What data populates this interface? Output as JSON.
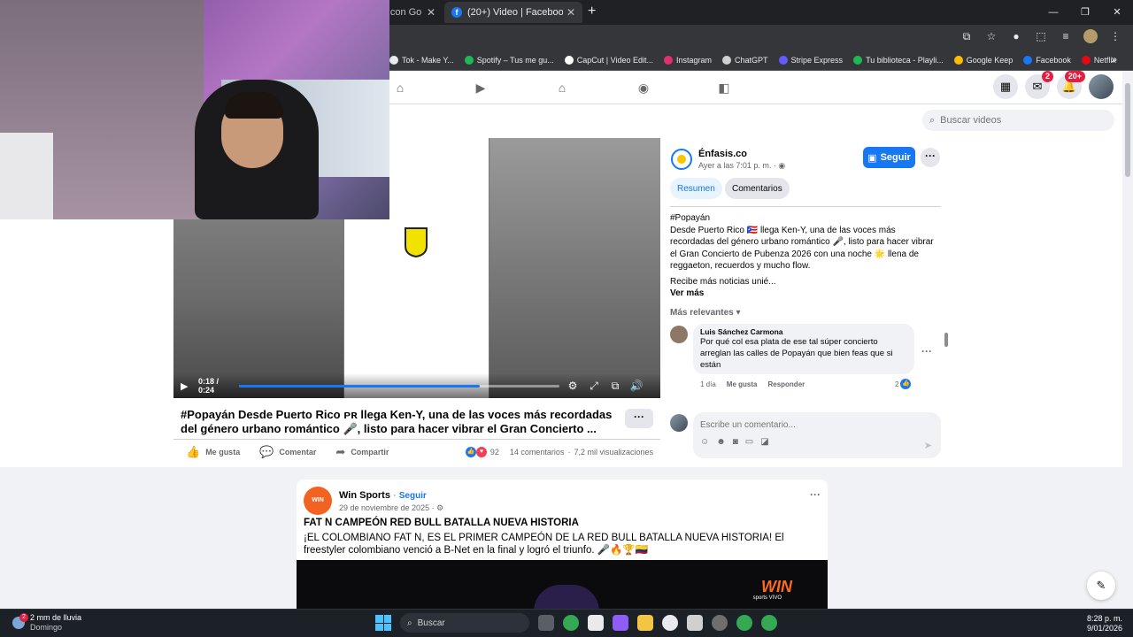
{
  "browser": {
    "tabs": [
      {
        "label": "ar con Go",
        "active": false
      },
      {
        "label": "(20+) Video | Facebook",
        "active": true
      }
    ],
    "new_tab": "+",
    "bookmarks": [
      {
        "label": "Tok - Make Y...",
        "color": "#e8eaed"
      },
      {
        "label": "Spotify – Tus me gu...",
        "color": "#1db954"
      },
      {
        "label": "CapCut | Video Edit...",
        "color": "#ffffff"
      },
      {
        "label": "Instagram",
        "color": "#e1306c"
      },
      {
        "label": "ChatGPT",
        "color": "#d0d0d0"
      },
      {
        "label": "Stripe Express",
        "color": "#635bff"
      },
      {
        "label": "Tu biblioteca - Playli...",
        "color": "#1db954"
      },
      {
        "label": "Google Keep",
        "color": "#fbbc04"
      },
      {
        "label": "Facebook",
        "color": "#1877f2"
      },
      {
        "label": "Netflix",
        "color": "#e50914"
      }
    ],
    "bookmarks_more": "»"
  },
  "facebook": {
    "top_badges": {
      "messenger": "2",
      "notifications": "20+"
    },
    "video_search_placeholder": "Buscar videos",
    "player": {
      "time": "0:18 / 0:24",
      "progress": 0.75
    },
    "post": {
      "title": "#Popayán Desde Puerto Rico ᴘʀ llega Ken-Y, una de las voces más recordadas del género urbano romántico 🎤, listo para hacer vibrar el Gran Concierto ...",
      "actions": {
        "like": "Me gusta",
        "comment": "Comentar",
        "share": "Compartir"
      },
      "reactions_count": "92",
      "comments_count": "14 comentarios",
      "views": "7,2 mil visualizaciones"
    },
    "panel": {
      "page_name": "Énfasis.co",
      "page_time": "Ayer a las 7:01 p. m. ·",
      "follow": "Seguir",
      "tabs": {
        "summary": "Resumen",
        "comments": "Comentarios"
      },
      "hashtag": "#Popayán",
      "description": "Desde Puerto Rico 🇵🇷 llega Ken-Y, una de las voces más recordadas del género urbano romántico 🎤, listo para hacer vibrar el Gran Concierto de Pubenza 2026 con una noche 🌟 llena de reggaeton, recuerdos y mucho flow.",
      "description_more": "Recibe más noticias unié...",
      "see_more": "Ver más",
      "relevance": "Más relevantes",
      "comment": {
        "author": "Luis Sánchez Carmona",
        "text": "Por qué col esa plata de ese tal súper concierto arreglan las calles de Popayán que bien feas que si están",
        "age": "1 día",
        "like": "Me gusta",
        "reply": "Responder",
        "likes": "2"
      },
      "write_placeholder": "Escribe un comentario..."
    },
    "post2": {
      "author": "Win Sports",
      "follow": "Seguir",
      "date": "29 de noviembre de 2025 ·",
      "headline": "FAT N CAMPEÓN RED BULL BATALLA NUEVA HISTORIA",
      "body": "¡EL COLOMBIANO FAT N, ES EL PRIMER CAMPEÓN DE LA RED BULL BATALLA NUEVA HISTORIA! El freestyler colombiano venció a B-Net en la final y logró el triunfo. 🎤🔥🏆🇨🇴",
      "logo_text": "WIN",
      "media_brand": "WIN",
      "media_sub": "sports VIVO"
    }
  },
  "taskbar": {
    "weather": "2 mm de lluvia",
    "weather_sub": "Domingo",
    "weather_badge": "2",
    "search": "Buscar",
    "time": "8:28 p. m.",
    "date": "9/01/2026"
  }
}
